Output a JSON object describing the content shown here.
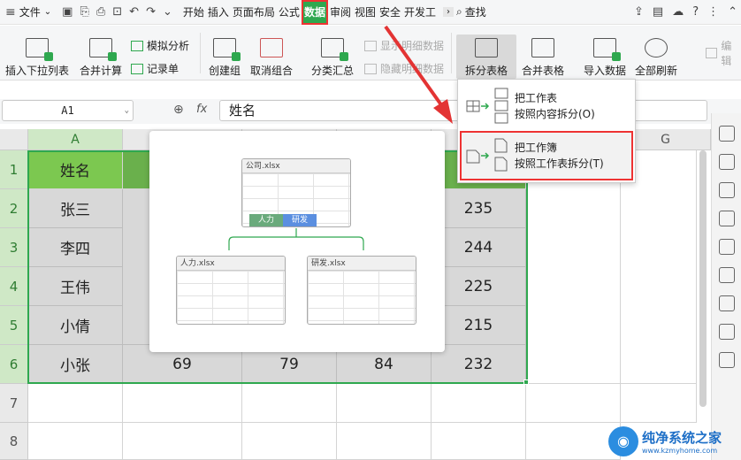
{
  "menubar": {
    "file_label": "文件",
    "tabs": [
      "开始",
      "插入",
      "页面布局",
      "公式",
      "数据",
      "审阅",
      "视图",
      "安全",
      "开发工"
    ],
    "active_tab": "数据",
    "search_label": "查找",
    "more_label": "›"
  },
  "ribbon": {
    "insert_dropdown": "插入下拉列表",
    "merge_calc": "合并计算",
    "simulate": "模拟分析",
    "record": "记录单",
    "create_group": "创建组",
    "ungroup": "取消组合",
    "subtotal": "分类汇总",
    "show_detail": "显示明细数据",
    "hide_detail": "隐藏明细数据",
    "split_table": "拆分表格",
    "merge_table": "合并表格",
    "import_data": "导入数据",
    "refresh_all": "全部刷新",
    "edit": "编辑"
  },
  "formula_bar": {
    "name_box": "A1",
    "fx": "fx",
    "value": "姓名"
  },
  "columns": [
    "A",
    "B",
    "C",
    "D",
    "E",
    "F",
    "G"
  ],
  "rows": [
    "1",
    "2",
    "3",
    "4",
    "5",
    "6",
    "7",
    "8"
  ],
  "table": {
    "names": [
      "姓名",
      "张三",
      "李四",
      "王伟",
      "小倩",
      "小张"
    ],
    "row6": [
      "69",
      "79",
      "84",
      "232"
    ],
    "col_e": [
      "235",
      "244",
      "225",
      "215"
    ]
  },
  "split_menu": {
    "item1_line1": "把工作表",
    "item1_line2": "按照内容拆分(O)",
    "item2_line1": "把工作簿",
    "item2_line2": "按照工作表拆分(T)"
  },
  "preview": {
    "source_file": "公司.xlsx",
    "tab1": "人力",
    "tab2": "研发",
    "out1": "人力.xlsx",
    "out2": "研发.xlsx"
  },
  "watermark": {
    "title": "纯净系统之家",
    "url": "www.kzmyhome.com"
  },
  "colors": {
    "accent": "#2fa84f",
    "highlight": "#e33333"
  }
}
